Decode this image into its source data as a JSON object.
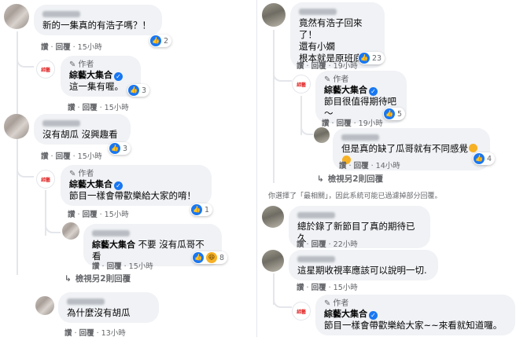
{
  "left": {
    "c1": {
      "text": "新的一集真的有浩子嗎？！",
      "reactions": "2",
      "like": "讚",
      "reply": "回覆",
      "time": "15小時"
    },
    "r1": {
      "author_tag": "作者",
      "name": "綜藝大集合",
      "text": "這一集有喔。",
      "reactions": "3",
      "like": "讚",
      "reply": "回覆",
      "time": "15小時"
    },
    "c2": {
      "text": "沒有胡瓜 沒興趣看",
      "reactions": "3",
      "like": "讚",
      "reply": "回覆",
      "time": "15小時"
    },
    "r2": {
      "author_tag": "作者",
      "name": "綜藝大集合",
      "text": "節目一樣會帶歡樂給大家的唷！",
      "reactions": "1",
      "like": "讚",
      "reply": "回覆",
      "time": "15小時"
    },
    "r3": {
      "mention": "綜藝大集合",
      "text": " 不要 沒有瓜哥不看",
      "reactions": "8",
      "like": "讚",
      "reply": "回覆",
      "time": "15小時"
    },
    "view_more": "檢視另2則回覆",
    "c3": {
      "text": "為什麼沒有胡瓜",
      "like": "讚",
      "reply": "回覆",
      "time": "13小時"
    }
  },
  "right": {
    "c1": {
      "lines": [
        "竟然有浩子回來了！",
        "還有小嫻",
        "根本就是原班底嘛"
      ],
      "reactions": "23",
      "like": "讚",
      "reply": "回覆",
      "time": "19小時"
    },
    "r1": {
      "author_tag": "作者",
      "name": "綜藝大集合",
      "text": "節目很值得期待吧～",
      "reactions": "5",
      "like": "讚",
      "reply": "回覆",
      "time": "19小時"
    },
    "r2": {
      "text": "但是真的缺了瓜哥就有不同感覺",
      "reactions": "4",
      "like": "讚",
      "reply": "回覆",
      "time": "14小時"
    },
    "view_more": "檢視另2則回覆",
    "notice": "你選擇了「最相關」，因此系統可能已過濾掉部分回覆。",
    "c2": {
      "text": "總於錄了新節目了真的期待已久",
      "like": "讚",
      "reply": "回覆",
      "time": "22小時"
    },
    "c3": {
      "text": "這星期收視率應該可以說明一切.",
      "like": "讚",
      "reply": "回覆",
      "time": "15小時"
    },
    "r3": {
      "author_tag": "作者",
      "name": "綜藝大集合",
      "text": "節目一樣會帶歡樂給大家~~來看就知道囉。"
    }
  },
  "colors": {
    "like_blue": "#1877f2",
    "bubble_bg": "#f0f2f5",
    "meta_gray": "#65676b"
  },
  "icons": {
    "like": "thumbs-up-icon",
    "haha": "haha-emoji-icon",
    "verified": "verified-badge-icon",
    "author": "pen-icon",
    "reply_arrow": "reply-arrow-icon"
  }
}
